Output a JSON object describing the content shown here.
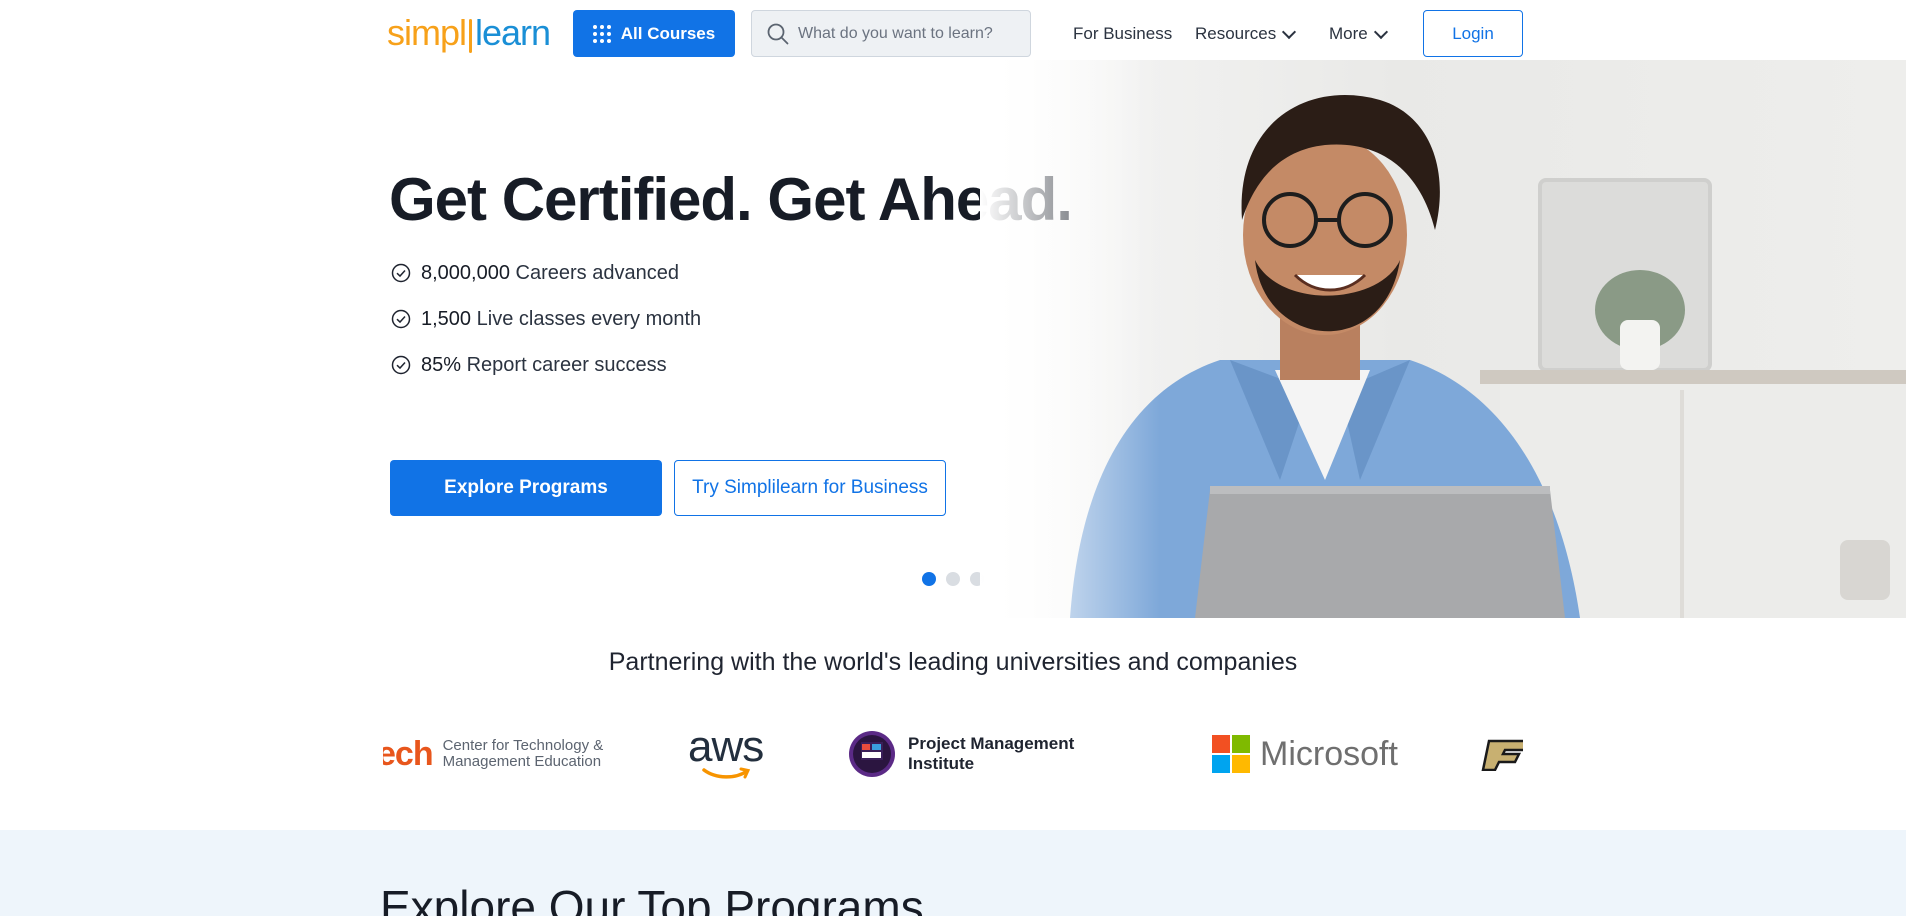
{
  "header": {
    "logo_part1": "simpl",
    "logo_part2": "learn",
    "all_courses_label": "All Courses",
    "search_placeholder": "What do you want to learn?",
    "nav": {
      "for_business": "For Business",
      "resources": "Resources",
      "more": "More"
    },
    "login_label": "Login"
  },
  "hero": {
    "headline": "Get Certified. Get Ahead.",
    "stats": [
      {
        "value": "8,000,000",
        "label": "Careers advanced"
      },
      {
        "value": "1,500",
        "label": "Live classes every month"
      },
      {
        "value": "85%",
        "label": "Report career success"
      }
    ],
    "explore_label": "Explore Programs",
    "business_label": "Try Simplilearn for Business",
    "carousel_active_index": 0,
    "carousel_count": 3
  },
  "partners": {
    "title": "Partnering with the world's leading universities and companies",
    "ict_big": "ech",
    "ict_line1": "Center for Technology &",
    "ict_line2": "Management Education",
    "aws_text": "aws",
    "pmi_line1": "Project Management",
    "pmi_line2": "Institute",
    "pmi_badge": "PMI",
    "microsoft_text": "Microsoft"
  },
  "programs": {
    "title": "Explore Our Top Programs"
  },
  "colors": {
    "primary": "#1173e6",
    "logo_orange": "#f7a11a",
    "logo_blue": "#1a8fd6",
    "programs_bg": "#eef5fb"
  }
}
